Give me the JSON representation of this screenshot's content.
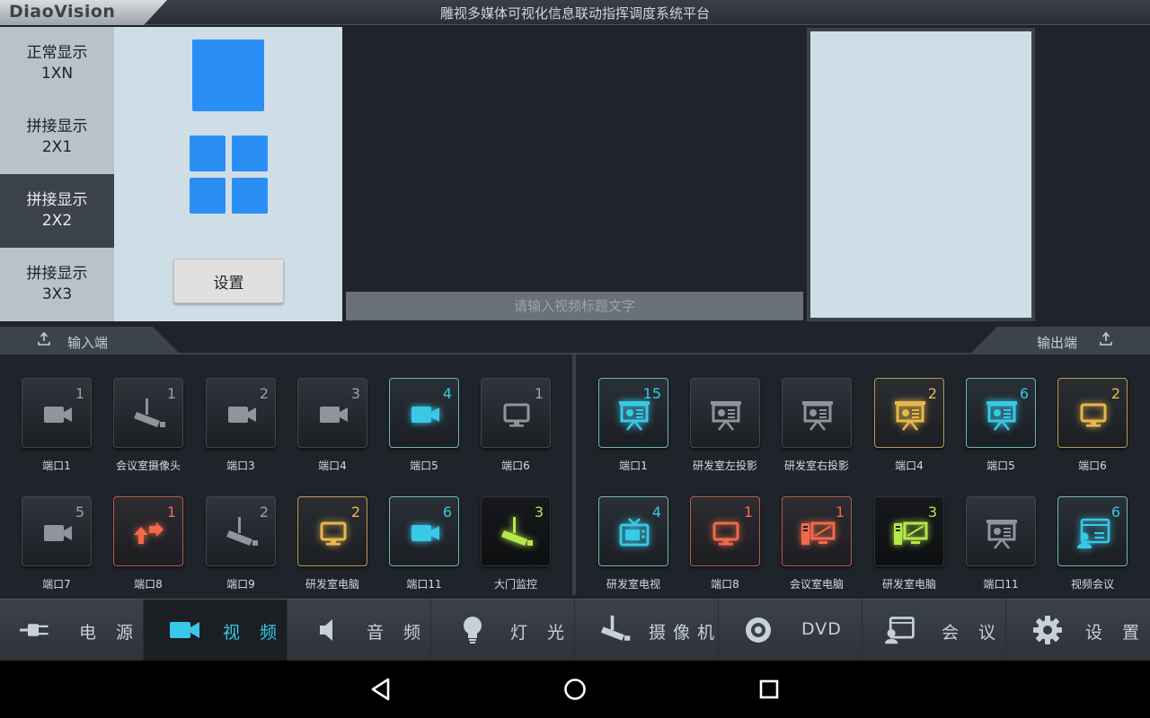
{
  "app": {
    "logo_text": "DiaoVision",
    "title": "雕视多媒体可视化信息联动指挥调度系统平台"
  },
  "layout": {
    "tabs": [
      {
        "line1": "正常显示",
        "line2": "1XN"
      },
      {
        "line1": "拼接显示",
        "line2": "2X1"
      },
      {
        "line1": "拼接显示",
        "line2": "2X2"
      },
      {
        "line1": "拼接显示",
        "line2": "3X3"
      }
    ],
    "active_tab": "拼接显示 2X2",
    "set_label": "设置"
  },
  "caption": {
    "placeholder": "请输入视频标题文字"
  },
  "sections": {
    "input_label": "输入端",
    "output_label": "输出端"
  },
  "inputs": [
    {
      "label": "端口1",
      "num": "1",
      "icon": "video-camera-icon",
      "state": "normal"
    },
    {
      "label": "会议室摄像头",
      "num": "1",
      "icon": "cctv-camera-icon",
      "state": "normal"
    },
    {
      "label": "端口3",
      "num": "2",
      "icon": "video-camera-icon",
      "state": "normal"
    },
    {
      "label": "端口4",
      "num": "3",
      "icon": "video-camera-icon",
      "state": "normal"
    },
    {
      "label": "端口5",
      "num": "4",
      "icon": "video-camera-icon",
      "state": "cyan"
    },
    {
      "label": "端口6",
      "num": "1",
      "icon": "monitor-icon",
      "state": "normal"
    },
    {
      "label": "端口7",
      "num": "5",
      "icon": "video-camera-icon",
      "state": "normal"
    },
    {
      "label": "端口8",
      "num": "1",
      "icon": "swap-arrows-icon",
      "state": "red"
    },
    {
      "label": "端口9",
      "num": "2",
      "icon": "cctv-camera-icon",
      "state": "normal"
    },
    {
      "label": "研发室电脑",
      "num": "2",
      "icon": "monitor-icon",
      "state": "gold"
    },
    {
      "label": "端口11",
      "num": "6",
      "icon": "video-camera-icon",
      "state": "cyan"
    },
    {
      "label": "大门监控",
      "num": "3",
      "icon": "cctv-camera-icon",
      "state": "green"
    }
  ],
  "outputs": [
    {
      "label": "端口1",
      "num": "15",
      "icon": "projector-screen-icon",
      "state": "cyan"
    },
    {
      "label": "研发室左投影",
      "num": "",
      "icon": "projector-screen-icon",
      "state": "normal"
    },
    {
      "label": "研发室右投影",
      "num": "",
      "icon": "projector-screen-icon",
      "state": "normal"
    },
    {
      "label": "端口4",
      "num": "2",
      "icon": "projector-screen-icon",
      "state": "gold"
    },
    {
      "label": "端口5",
      "num": "6",
      "icon": "projector-screen-icon",
      "state": "cyan"
    },
    {
      "label": "端口6",
      "num": "2",
      "icon": "monitor-icon",
      "state": "gold"
    },
    {
      "label": "研发室电视",
      "num": "4",
      "icon": "tv-icon",
      "state": "cyan"
    },
    {
      "label": "端口8",
      "num": "1",
      "icon": "monitor-icon",
      "state": "red"
    },
    {
      "label": "会议室电脑",
      "num": "1",
      "icon": "desktop-pc-icon",
      "state": "red"
    },
    {
      "label": "研发室电脑",
      "num": "3",
      "icon": "desktop-pc-icon",
      "state": "green"
    },
    {
      "label": "端口11",
      "num": "",
      "icon": "projector-screen-icon",
      "state": "normal"
    },
    {
      "label": "视频会议",
      "num": "6",
      "icon": "video-conference-icon",
      "state": "cyan"
    }
  ],
  "nav": [
    {
      "label": "电 源",
      "icon": "power-plug-icon"
    },
    {
      "label": "视 频",
      "icon": "video-camera-icon"
    },
    {
      "label": "音 频",
      "icon": "speaker-icon"
    },
    {
      "label": "灯 光",
      "icon": "light-bulb-icon"
    },
    {
      "label": "摄像机",
      "icon": "cctv-camera-icon"
    },
    {
      "label": "DVD",
      "icon": "disc-icon"
    },
    {
      "label": "会 议",
      "icon": "video-conference-icon"
    },
    {
      "label": "设 置",
      "icon": "gear-icon"
    }
  ],
  "nav_active": "视 频",
  "colors": {
    "accent_blue": "#2a8ff5",
    "cyan": "#38c9e6",
    "gold": "#e7b84a",
    "red": "#f06a4a",
    "green": "#b6e84a",
    "grey_icon": "#8f959b"
  },
  "system_nav": [
    "back-icon",
    "home-icon",
    "recents-icon"
  ]
}
